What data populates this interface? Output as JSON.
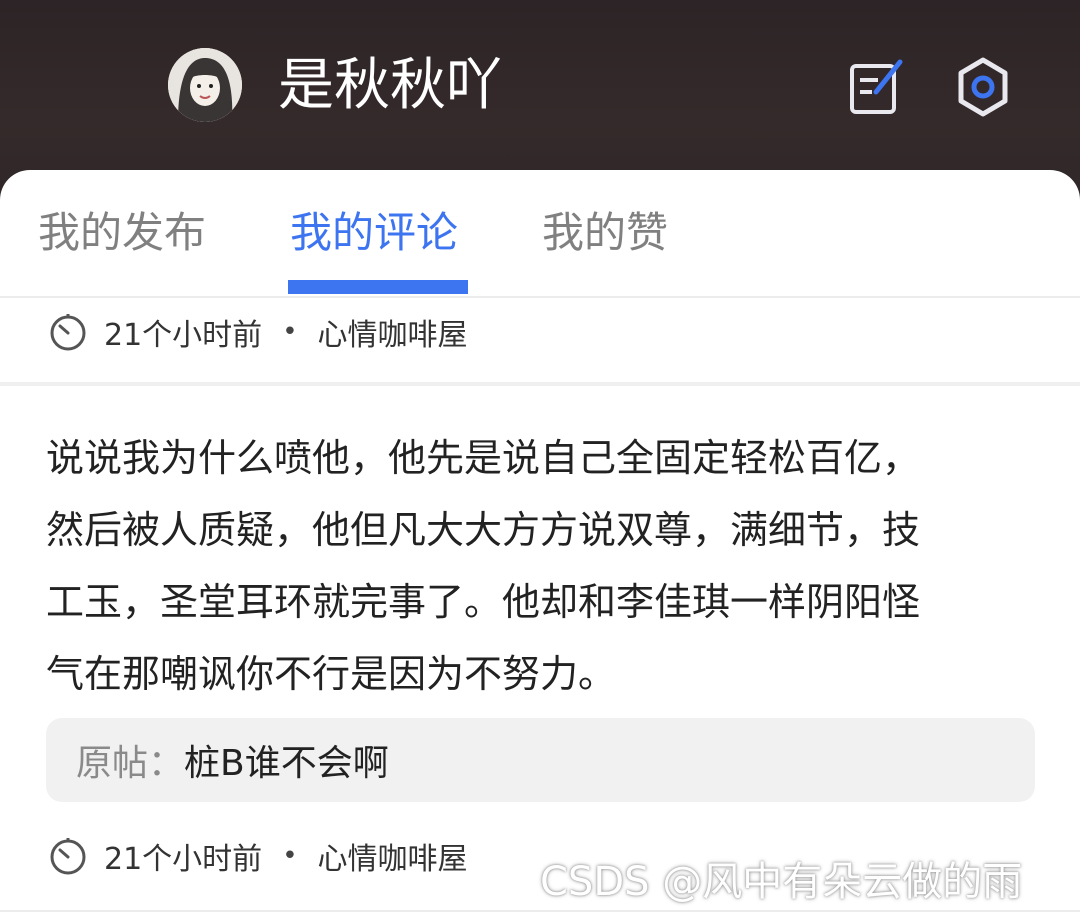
{
  "header": {
    "username": "是秋秋吖",
    "edit_icon": "edit-note-icon",
    "settings_icon": "gear-icon",
    "accent_color": "#3d74f0"
  },
  "tabs": [
    {
      "label": "我的发布",
      "active": false
    },
    {
      "label": "我的评论",
      "active": true
    },
    {
      "label": "我的赞",
      "active": false
    }
  ],
  "previous_item": {
    "time": "21个小时前",
    "separator": "•",
    "board": "心情咖啡屋"
  },
  "comment_item": {
    "lines": [
      "说说我为什么喷他，他先是说自己全固定轻松百亿，",
      "然后被人质疑，他但凡大大方方说双尊，满细节，技",
      "工玉，圣堂耳环就完事了。他却和李佳琪一样阴阳怪",
      "气在那嘲讽你不行是因为不努力。"
    ],
    "quote_label": "原帖：",
    "quote_text": "桩B谁不会啊",
    "time": "21个小时前",
    "separator": "•",
    "board": "心情咖啡屋"
  },
  "watermark": "CSDS @风中有朵云做的雨"
}
